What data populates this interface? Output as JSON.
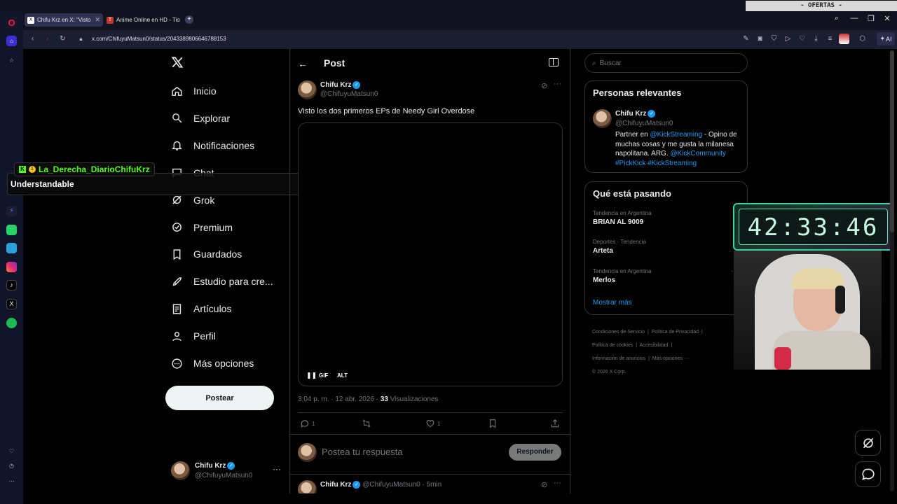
{
  "browser": {
    "ofertas": "- OFERTAS -",
    "tabs": [
      {
        "label": "Chifu Krz en X: \"Visto los"
      },
      {
        "label": "Anime Online en HD - Tio"
      }
    ],
    "url": "x.com/ChifuyuMatsun0/status/2043389806646788153",
    "ai_label": "AI"
  },
  "nav": {
    "items": [
      {
        "label": "Inicio",
        "icon": "home-icon"
      },
      {
        "label": "Explorar",
        "icon": "search-icon"
      },
      {
        "label": "Notificaciones",
        "icon": "bell-icon"
      },
      {
        "label": "Chat",
        "icon": "chat-icon"
      },
      {
        "label": "Grok",
        "icon": "grok-icon"
      },
      {
        "label": "Premium",
        "icon": "premium-icon"
      },
      {
        "label": "Guardados",
        "icon": "bookmark-icon"
      },
      {
        "label": "Estudio para cre...",
        "icon": "rocket-icon"
      },
      {
        "label": "Artículos",
        "icon": "article-icon"
      },
      {
        "label": "Perfil",
        "icon": "profile-icon"
      },
      {
        "label": "Más opciones",
        "icon": "more-circle-icon"
      }
    ],
    "post_button": "Postear",
    "account": {
      "name": "Chifu Krz",
      "handle": "@ChifuyuMatsun0"
    }
  },
  "overlay": {
    "kick_user": "La_Derecha_DiarioChifuKrz",
    "kick_message": "Understandable",
    "timer": "42:33:46"
  },
  "post": {
    "header_title": "Post",
    "author_name": "Chifu Krz",
    "author_handle": "@ChifuyuMatsun0",
    "text": "Visto los dos primeros EPs de Needy Girl Overdose",
    "media_badges": {
      "gif": "GIF",
      "alt": "ALT"
    },
    "timestamp": "3:04 p. m. · 12 abr. 2026 · ",
    "views_count": "33",
    "views_label": " Visualizaciones",
    "replies": "1",
    "likes": "1",
    "reply_placeholder": "Postea tu respuesta",
    "reply_button": "Responder",
    "next_reply": {
      "name": "Chifu Krz",
      "handle_time": "@ChifuyuMatsun0 · 5min"
    }
  },
  "right": {
    "search_placeholder": "Buscar",
    "relevant": {
      "title": "Personas relevantes",
      "name": "Chifu Krz",
      "handle": "@ChifuyuMatsun0",
      "bio_1": "Partner en ",
      "bio_link_1": "@KickStreaming",
      "bio_2": " - Opino de muchas cosas y me gusta la milanesa napolitana. ARG. ",
      "bio_link_2": "@KickCommunity",
      "bio_tags": "#PickKick #KickStreaming"
    },
    "trends": {
      "title": "Qué está pasando",
      "items": [
        {
          "category": "Tendencia en Argentina",
          "name": "BRIAN AL 9009"
        },
        {
          "category": "Deportes · Tendencia",
          "name": "Arteta"
        },
        {
          "category": "Tendencia en Argentina",
          "name": "Merlos"
        }
      ],
      "show_more": "Mostrar más"
    },
    "footer": {
      "links": [
        "Condiciones de Servicio",
        "Política de Privacidad",
        "Política de cookies",
        "Accesibilidad",
        "Información de anuncios",
        "Más opciones ···"
      ],
      "copyright": "© 2026 X Corp."
    }
  },
  "colors": {
    "accent": "#1d9bf0",
    "kick_green": "#53fc18",
    "timer_text": "#c9f7e6"
  }
}
